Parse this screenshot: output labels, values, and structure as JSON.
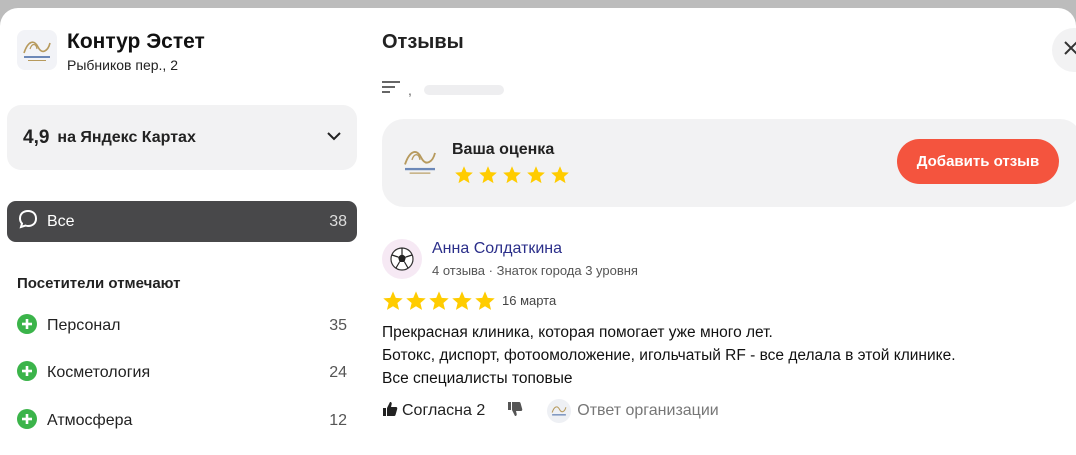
{
  "organization": {
    "name": "Контур Эстет",
    "address": "Рыбников пер., 2"
  },
  "rating": {
    "value": "4,9",
    "source": "на Яндекс Картах"
  },
  "filters": {
    "all_label": "Все",
    "all_count": "38"
  },
  "visitors": {
    "title": "Посетители отмечают",
    "aspects": [
      {
        "label": "Персонал",
        "count": "35"
      },
      {
        "label": "Косметология",
        "count": "24"
      },
      {
        "label": "Атмосфера",
        "count": "12"
      }
    ]
  },
  "reviews": {
    "title": "Отзывы",
    "sort_separator": ",",
    "my_rating_label": "Ваша оценка",
    "my_rating_stars": 5,
    "add_review_label": "Добавить отзыв"
  },
  "review": {
    "author": "Анна Солдаткина",
    "meta": "4 отзыва · Знаток города 3 уровня",
    "stars": 5,
    "date": "16 марта",
    "lines": [
      "Прекрасная клиника, которая помогает уже много лет.",
      "Ботокс, диспорт, фотоомоложение, игольчатый RF - все делала в этой клинике.",
      "Все специалисты топовые"
    ],
    "agree_label": "Согласна 2",
    "org_answer_label": "Ответ организации"
  },
  "colors": {
    "accent": "#f4543e",
    "star": "#fc0",
    "plus_green": "#3bb44a",
    "author_link": "#2b2f8a"
  },
  "icons": {
    "chevron": "chevron-down-icon",
    "chat": "chat-bubble-icon",
    "plus": "plus-circle-icon",
    "close": "close-icon",
    "sort": "sort-icon",
    "like": "thumb-up-icon",
    "dislike": "thumb-down-icon"
  }
}
